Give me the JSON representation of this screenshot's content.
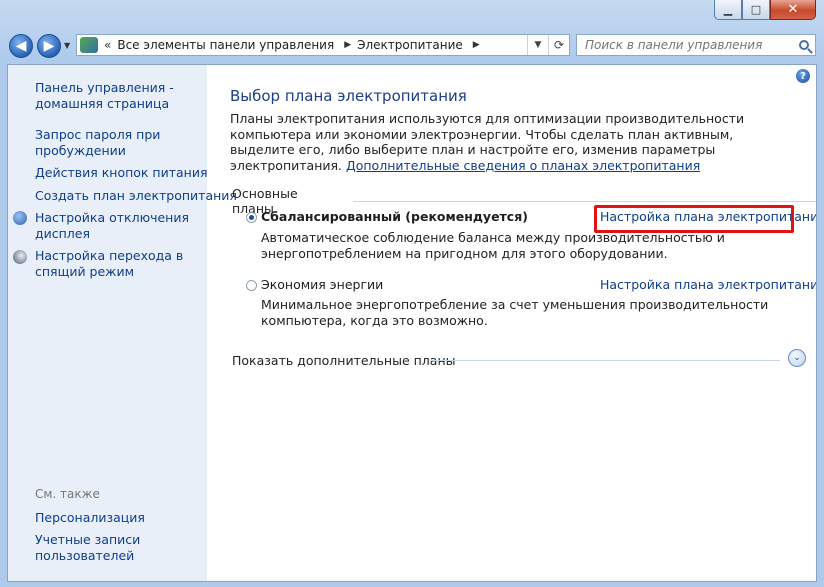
{
  "window": {
    "minimize_glyph": "▁",
    "maximize_glyph": "□",
    "close_glyph": "✕"
  },
  "navbar": {
    "back_glyph": "◀",
    "forward_glyph": "▶",
    "overflow": "«",
    "breadcrumbs": [
      "Все элементы панели управления",
      "Электропитание"
    ],
    "refresh_glyph": "⟳",
    "search_placeholder": "Поиск в панели управления"
  },
  "sidebar": {
    "items": [
      {
        "label": "Панель управления -"
      },
      {
        "label": "домашняя страница"
      },
      {
        "label": "Запрос пароля при"
      },
      {
        "label": "пробуждении"
      },
      {
        "label": "Действия кнопок питания"
      },
      {
        "label": "Создать план электропитания"
      },
      {
        "label": "Настройка отключения"
      },
      {
        "label": "дисплея"
      },
      {
        "label": "Настройка перехода в"
      },
      {
        "label": "спящий режим"
      }
    ],
    "see_also_title": "См. также",
    "see_also": [
      {
        "label": "Персонализация"
      },
      {
        "label": "Учетные записи"
      },
      {
        "label": "пользователей"
      }
    ]
  },
  "main": {
    "help_glyph": "?",
    "title": "Выбор плана электропитания",
    "intro": "Планы электропитания используются для оптимизации производительности компьютера или экономии электроэнергии. Чтобы сделать план активным, выделите его, либо выберите план и настройте его, изменив параметры электропитания. ",
    "intro_link": "Дополнительные сведения о планах электропитания",
    "group_title": "Основные планы",
    "plans": [
      {
        "name": "Сбалансированный (рекомендуется)",
        "selected": true,
        "description": "Автоматическое соблюдение баланса между производительностью и энергопотреблением на пригодном для этого оборудовании.",
        "link": "Настройка плана электропитания"
      },
      {
        "name": "Экономия энергии",
        "selected": false,
        "description": "Минимальное энергопотребление за счет уменьшения производительности компьютера, когда это возможно.",
        "link": "Настройка плана электропитания"
      }
    ],
    "show_more": "Показать дополнительные планы",
    "expand_glyph": "⌄"
  },
  "colors": {
    "highlight": "#e21212",
    "link": "#0e3e8c",
    "title": "#1e3e87"
  }
}
